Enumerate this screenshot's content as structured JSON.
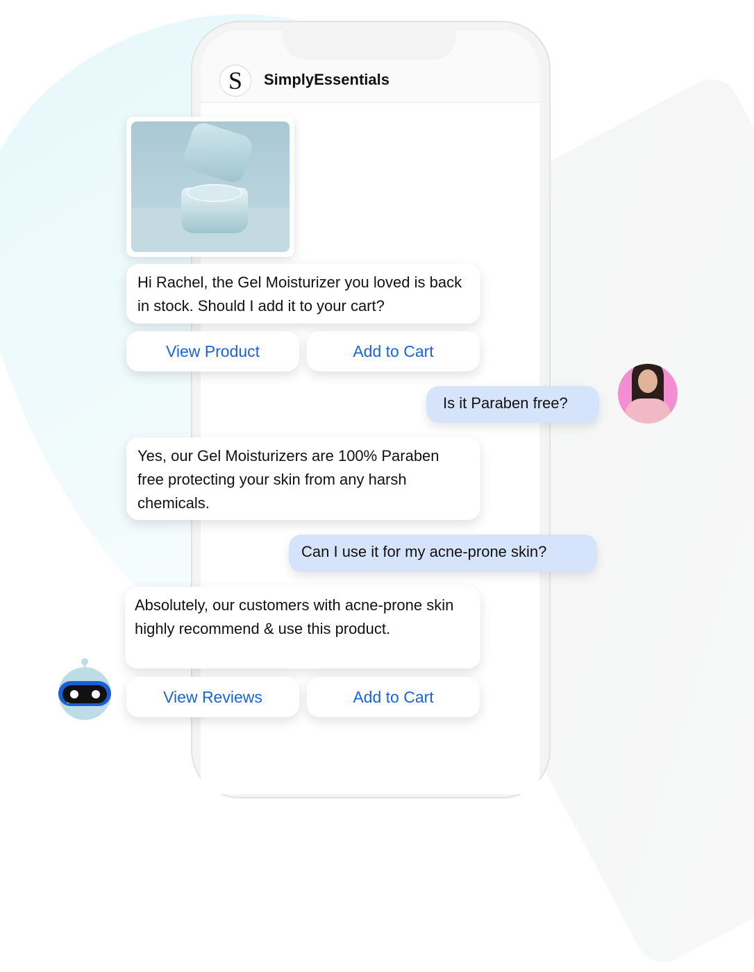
{
  "app": {
    "brand_initial": "S",
    "brand_name": "SimplyEssentials"
  },
  "messages": [
    {
      "from": "bot",
      "text": "Hi Rachel, the Gel Moisturizer you loved is back in stock. Should I add it to your cart?"
    },
    {
      "from": "user",
      "text": "Is it Paraben free?"
    },
    {
      "from": "bot",
      "text": "Yes, our Gel Moisturizers are 100% Paraben free protecting your skin from any harsh chemicals."
    },
    {
      "from": "user",
      "text": "Can I use it for my acne-prone skin?"
    },
    {
      "from": "bot",
      "text": "Absolutely, our customers with acne-prone skin highly recommend & use this product."
    }
  ],
  "buttons": {
    "view_product": "View Product",
    "add_to_cart_1": "Add to Cart",
    "view_reviews": "View Reviews",
    "add_to_cart_2": "Add to Cart"
  },
  "colors": {
    "accent": "#1a63d8",
    "user_bubble": "#d6e4fb",
    "bot_blue": "#1a5fd6"
  },
  "icons": {
    "product": "gel-moisturizer-jar-image",
    "user": "user-avatar-photo",
    "bot": "robot-icon"
  }
}
